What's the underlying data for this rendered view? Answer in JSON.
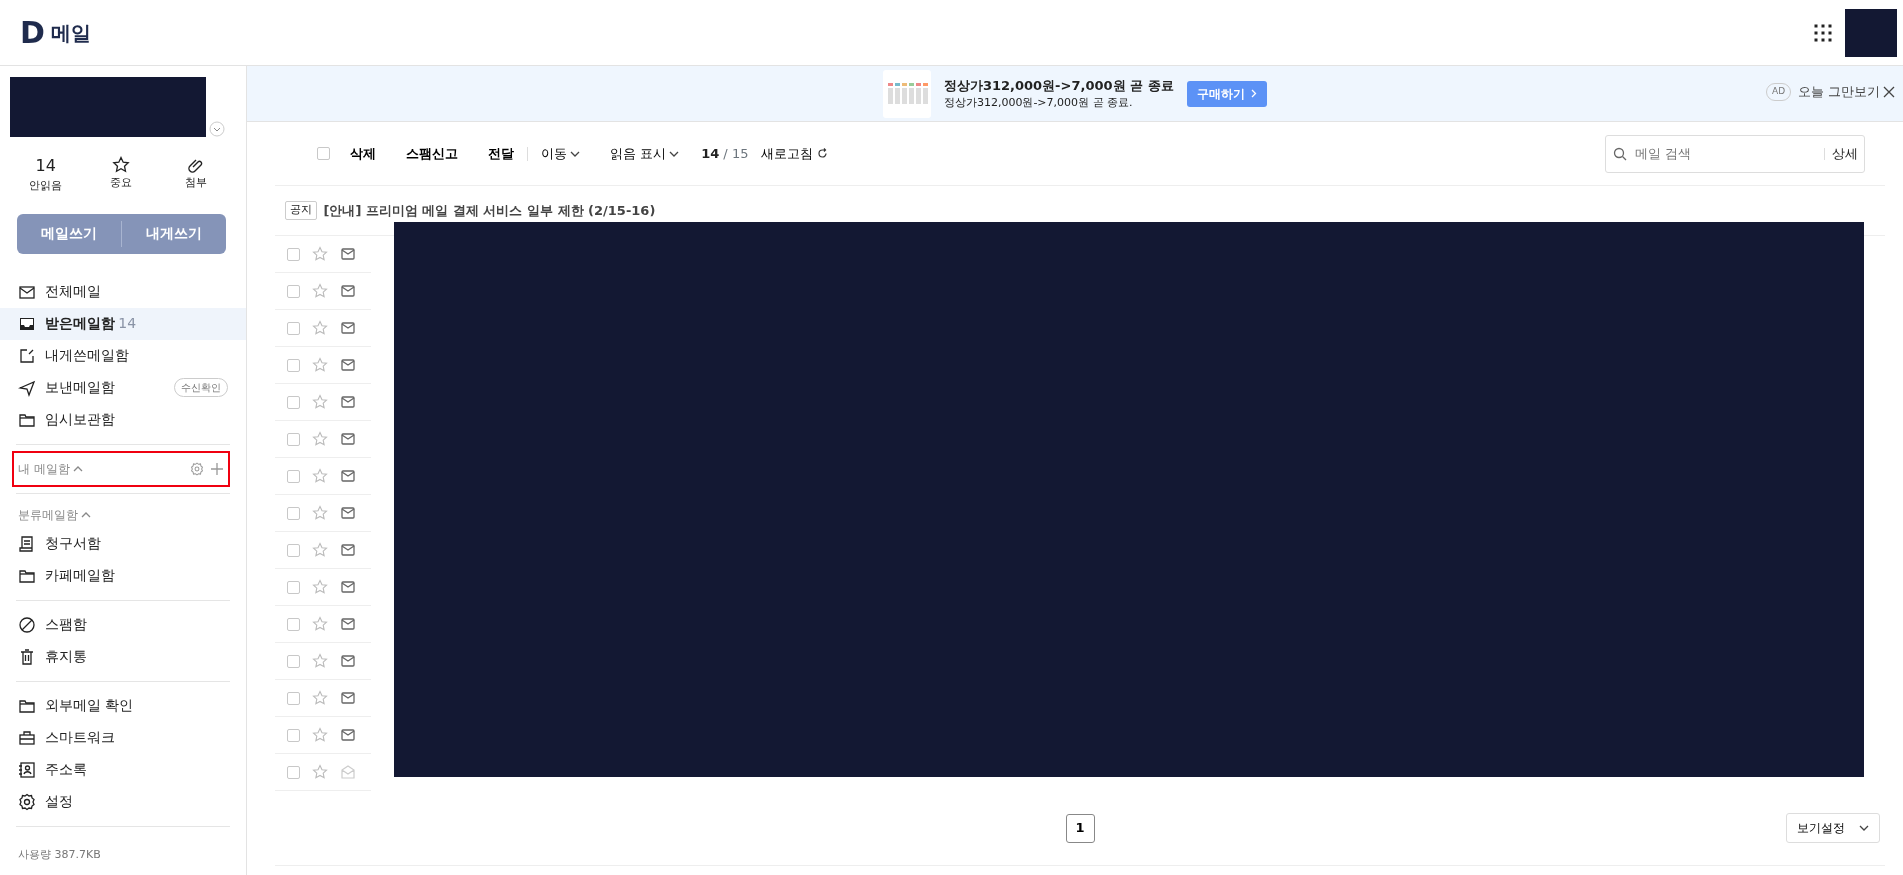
{
  "header": {
    "logo": "D",
    "title": "메일"
  },
  "account": {
    "stats": [
      {
        "kind": "count",
        "value": "14",
        "label": "안읽음"
      },
      {
        "kind": "star",
        "label": "중요"
      },
      {
        "kind": "clip",
        "label": "첨부"
      }
    ],
    "compose_buttons": [
      "메일쓰기",
      "내게쓰기"
    ]
  },
  "folders": [
    {
      "kind": "mail",
      "label": "전체메일",
      "selected": false
    },
    {
      "kind": "inbox",
      "label": "받은메일함",
      "count": "14",
      "selected": true
    },
    {
      "kind": "memo",
      "label": "내게쓴메일함",
      "selected": false
    },
    {
      "kind": "send",
      "label": "보낸메일함",
      "badge": "수신확인",
      "selected": false
    },
    {
      "kind": "folder",
      "label": "임시보관함",
      "selected": false
    }
  ],
  "my_mailbox": {
    "label": "내 메일함",
    "expanded": true,
    "highlighted": true
  },
  "categorized": {
    "label": "분류메일함",
    "expanded": true,
    "items": [
      {
        "kind": "receipt",
        "label": "청구서함"
      },
      {
        "kind": "folder",
        "label": "카페메일함"
      }
    ]
  },
  "trash_group": [
    {
      "kind": "spam",
      "label": "스팸함"
    },
    {
      "kind": "trash",
      "label": "휴지통"
    }
  ],
  "tools": [
    {
      "kind": "folder",
      "label": "외부메일 확인"
    },
    {
      "kind": "briefcase",
      "label": "스마트워크"
    },
    {
      "kind": "contacts",
      "label": "주소록"
    },
    {
      "kind": "gear",
      "label": "설정"
    }
  ],
  "usage": "사용량 387.7KB",
  "ad": {
    "title": "정상가312,000원->7,000원 곧 종료",
    "subtitle": "정상가312,000원->7,000원 곧 종료.",
    "button": "구매하기",
    "badge": "AD",
    "dismiss": "오늘 그만보기"
  },
  "toolbar": {
    "actions": [
      "삭제",
      "스팸신고",
      "전달"
    ],
    "menus": [
      "이동",
      "읽음 표시"
    ],
    "select_all": false,
    "unread": "14",
    "separator": "/",
    "total": "15",
    "refresh": "새로고침"
  },
  "search": {
    "placeholder": "메일 검색",
    "detail": "상세"
  },
  "notice": {
    "tag": "공지",
    "title": "[안내] 프리미엄 메일 결제 서비스 일부 제한 (2/15-16)"
  },
  "messages": [
    {
      "checked": false,
      "starred": false,
      "read": false
    },
    {
      "checked": false,
      "starred": false,
      "read": false
    },
    {
      "checked": false,
      "starred": false,
      "read": false
    },
    {
      "checked": false,
      "starred": false,
      "read": false
    },
    {
      "checked": false,
      "starred": false,
      "read": false
    },
    {
      "checked": false,
      "starred": false,
      "read": false
    },
    {
      "checked": false,
      "starred": false,
      "read": false
    },
    {
      "checked": false,
      "starred": false,
      "read": false
    },
    {
      "checked": false,
      "starred": false,
      "read": false
    },
    {
      "checked": false,
      "starred": false,
      "read": false
    },
    {
      "checked": false,
      "starred": false,
      "read": false
    },
    {
      "checked": false,
      "starred": false,
      "read": false
    },
    {
      "checked": false,
      "starred": false,
      "read": false
    },
    {
      "checked": false,
      "starred": false,
      "read": false
    },
    {
      "checked": false,
      "starred": false,
      "read": true
    }
  ],
  "pages": [
    {
      "label": "1",
      "selected": true
    }
  ],
  "view_settings": "보기설정"
}
